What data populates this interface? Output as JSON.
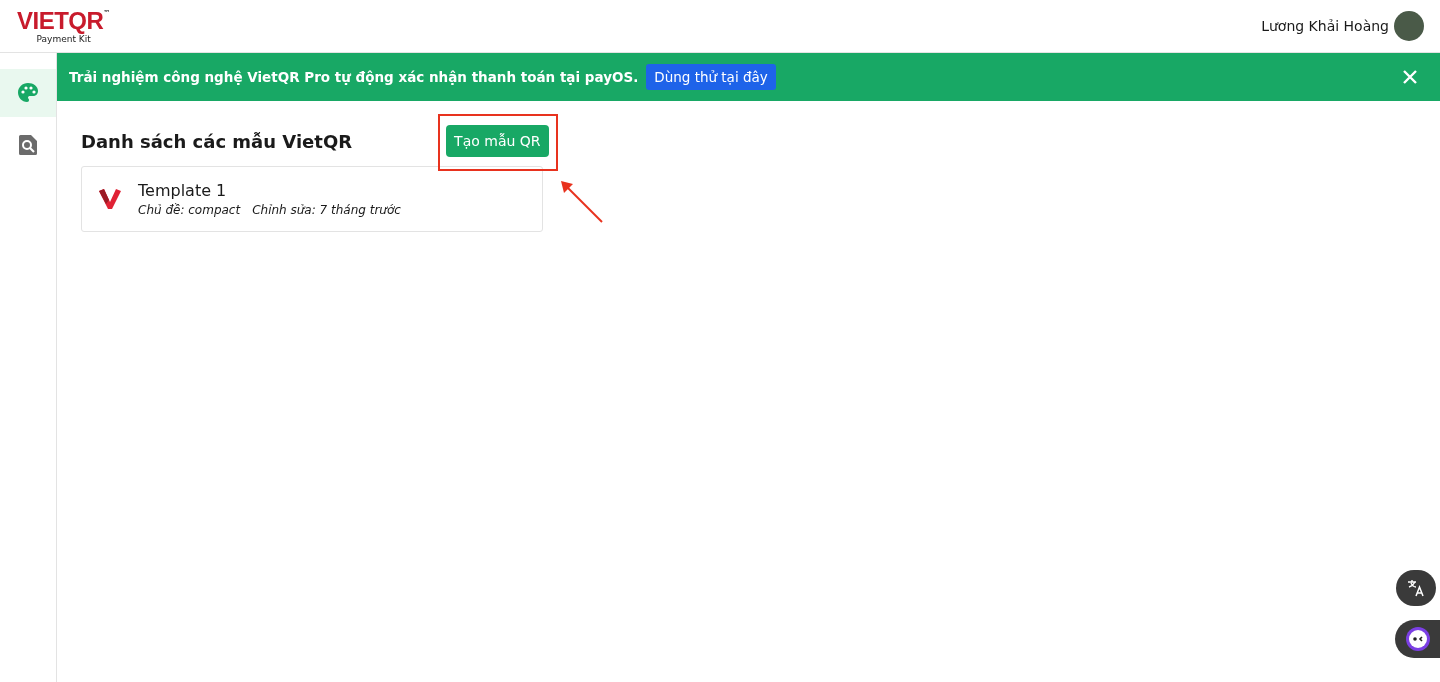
{
  "header": {
    "logo": {
      "wordmark": "VIETQR",
      "trademark": "™",
      "subtitle": "Payment Kit"
    },
    "user_name": "Lương Khải Hoàng"
  },
  "sidebar": {
    "items": [
      {
        "kind": "palette",
        "selected": true
      },
      {
        "kind": "search-document",
        "selected": false
      }
    ]
  },
  "banner": {
    "text": "Trải nghiệm công nghệ VietQR Pro tự động xác nhận thanh toán tại payOS.",
    "button": "Dùng thử tại đây"
  },
  "page": {
    "title": "Danh sách các mẫu VietQR",
    "create_button": "Tạo mẫu QR",
    "highlighted": true,
    "templates": [
      {
        "name": "Template 1",
        "theme": "Chủ đề: compact",
        "edited": "Chỉnh sửa: 7 tháng trước"
      }
    ]
  }
}
